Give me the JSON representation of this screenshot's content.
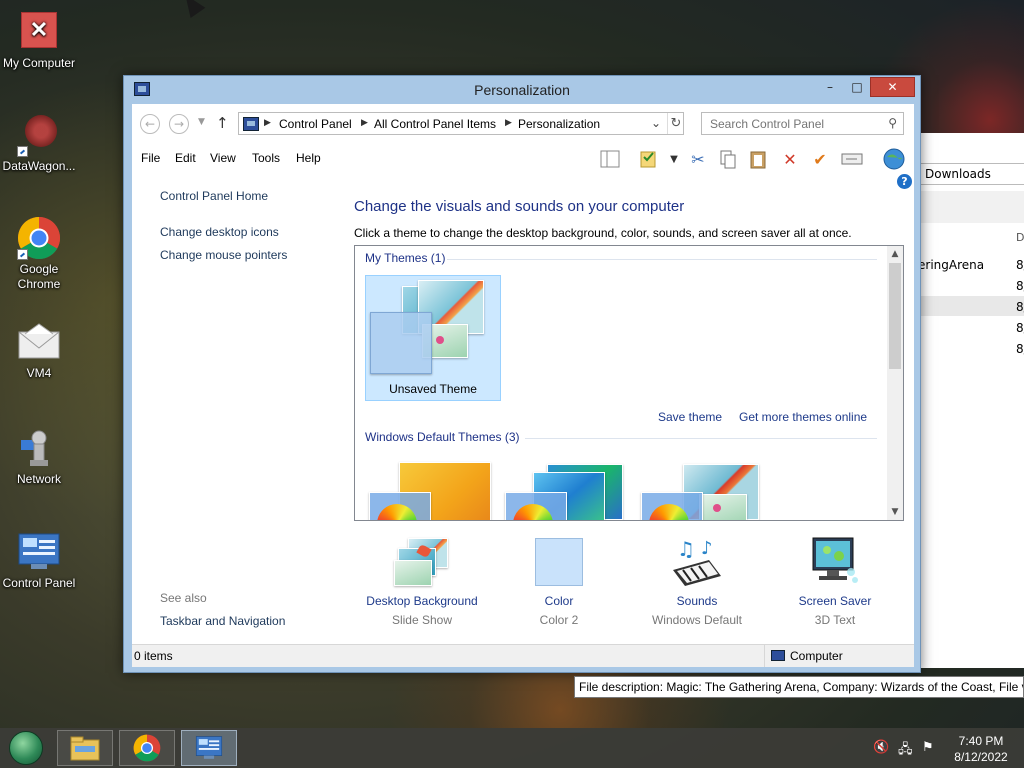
{
  "desktop": {
    "icons": [
      {
        "label": "My Computer"
      },
      {
        "label": "DataWagon..."
      },
      {
        "label": "Google Chrome"
      },
      {
        "label": "VM4"
      },
      {
        "label": "Network"
      },
      {
        "label": "Control Panel"
      }
    ]
  },
  "bg_window": {
    "address": "Downloads",
    "col_header": "D",
    "rows": [
      "eringArena",
      "8/",
      "8/",
      "8/",
      "8/",
      "8/"
    ]
  },
  "window": {
    "title": "Personalization",
    "controls": {
      "minimize": "–",
      "maximize": "□",
      "close": "✕"
    }
  },
  "nav": {
    "breadcrumb": [
      "Control Panel",
      "All Control Panel Items",
      "Personalization"
    ],
    "search_placeholder": "Search Control Panel"
  },
  "menu": [
    "File",
    "Edit",
    "View",
    "Tools",
    "Help"
  ],
  "left_pane": {
    "home": "Control Panel Home",
    "links": [
      "Change desktop icons",
      "Change mouse pointers"
    ],
    "see_also_label": "See also",
    "see_also_links": [
      "Taskbar and Navigation"
    ]
  },
  "main": {
    "heading": "Change the visuals and sounds on your computer",
    "subtext": "Click a theme to change the desktop background, color, sounds, and screen saver all at once.",
    "my_themes_label": "My Themes (1)",
    "my_theme_name": "Unsaved Theme",
    "save_theme": "Save theme",
    "more_themes": "Get more themes online",
    "default_themes_label": "Windows Default Themes (3)"
  },
  "settings": [
    {
      "label": "Desktop Background",
      "value": "Slide Show"
    },
    {
      "label": "Color",
      "value": "Color 2"
    },
    {
      "label": "Sounds",
      "value": "Windows Default"
    },
    {
      "label": "Screen Saver",
      "value": "3D Text"
    }
  ],
  "status": {
    "items": "0 items",
    "location": "Computer"
  },
  "tooltip": "File description: Magic: The Gathering Arena, Company: Wizards of the Coast, File ve",
  "taskbar": {
    "time": "7:40 PM",
    "date": "8/12/2022"
  },
  "colors": {
    "link": "#1e3a8a",
    "heading": "#1e3287",
    "close_button": "#c94a3e",
    "window_frame": "#a9c8e6"
  }
}
